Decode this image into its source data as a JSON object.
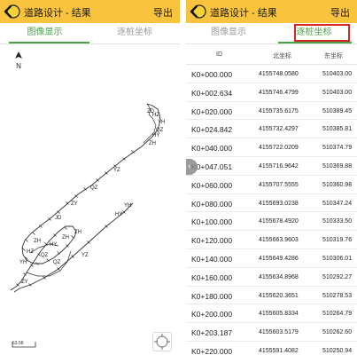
{
  "left_screen": {
    "header": {
      "title": "道路设计 - 结果",
      "export_label": "导出"
    },
    "tabs": [
      {
        "label": "图像显示",
        "active": true
      },
      {
        "label": "逐桩坐标",
        "active": false
      }
    ],
    "north_label": "N",
    "scale_label": "63.58",
    "plot_labels": [
      "ZD",
      "HZ",
      "YH",
      "QZ",
      "HY",
      "ZH",
      "YZ",
      "QZ",
      "ZY",
      "JD",
      "ZH",
      "HZ",
      "YH",
      "QZ",
      "HY",
      "ZH",
      "ZH",
      "HY",
      "YH",
      "YZ",
      "QZ",
      "ZY"
    ]
  },
  "right_screen": {
    "header": {
      "title": "道路设计 - 结果",
      "export_label": "导出"
    },
    "tabs": [
      {
        "label": "图像显示",
        "active": false
      },
      {
        "label": "逐桩坐标",
        "active": true
      }
    ],
    "table": {
      "columns": [
        "ID",
        "北坐标",
        "东坐标"
      ],
      "rows": [
        [
          "K0+000.000",
          "4155748.0580",
          "510403.00"
        ],
        [
          "K0+002.634",
          "4155746.4799",
          "510403.00"
        ],
        [
          "K0+020.000",
          "4155735.6175",
          "510389.45"
        ],
        [
          "K0+024.842",
          "4155732.4297",
          "510385.81"
        ],
        [
          "K0+040.000",
          "4155722.0209",
          "510374.79"
        ],
        [
          "K0+047.051",
          "4155716.9642",
          "510369.88"
        ],
        [
          "K0+060.000",
          "4155707.5555",
          "510360.98"
        ],
        [
          "K0+080.000",
          "4155693.0238",
          "510347.24"
        ],
        [
          "K0+100.000",
          "4155678.4920",
          "510333.50"
        ],
        [
          "K0+120.000",
          "4155663.9603",
          "510319.76"
        ],
        [
          "K0+140.000",
          "4155649.4286",
          "510306.01"
        ],
        [
          "K0+160.000",
          "4155634.8968",
          "510292.27"
        ],
        [
          "K0+180.000",
          "4155620.3651",
          "510278.53"
        ],
        [
          "K0+200.000",
          "4155605.8334",
          "510264.79"
        ],
        [
          "K0+203.187",
          "4155603.5179",
          "510262.60"
        ],
        [
          "K0+220.000",
          "4155591.4082",
          "510250.94"
        ]
      ]
    }
  },
  "colors": {
    "header_bg": "#f9c33d",
    "tab_active": "#4aa34a",
    "highlight_border": "#d9251d"
  }
}
